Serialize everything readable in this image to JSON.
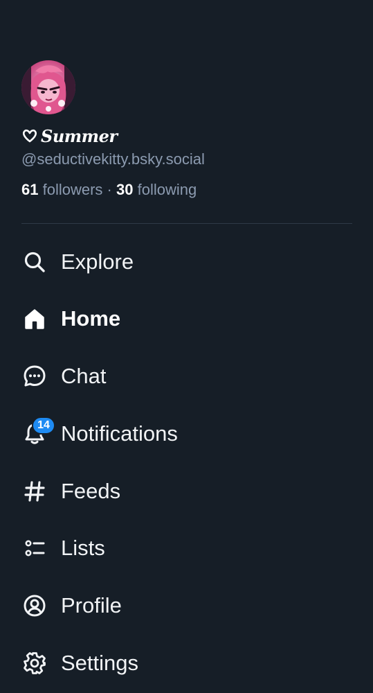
{
  "profile": {
    "display_name": "Summer",
    "handle": "@seductivekitty.bsky.social",
    "followers_count": "61",
    "followers_label": "followers",
    "separator": "·",
    "following_count": "30",
    "following_label": "following"
  },
  "nav": {
    "items": [
      {
        "label": "Explore",
        "icon": "search-icon"
      },
      {
        "label": "Home",
        "icon": "home-icon",
        "active": true
      },
      {
        "label": "Chat",
        "icon": "chat-bubble-icon"
      },
      {
        "label": "Notifications",
        "icon": "bell-icon",
        "badge": "14"
      },
      {
        "label": "Feeds",
        "icon": "hashtag-icon"
      },
      {
        "label": "Lists",
        "icon": "list-icon"
      },
      {
        "label": "Profile",
        "icon": "user-circle-icon"
      },
      {
        "label": "Settings",
        "icon": "gear-icon"
      }
    ]
  },
  "colors": {
    "background": "#161e27",
    "text": "#f1f3f5",
    "muted": "#8c9bb0",
    "badge": "#1e8bf3",
    "divider": "#2e3947"
  }
}
